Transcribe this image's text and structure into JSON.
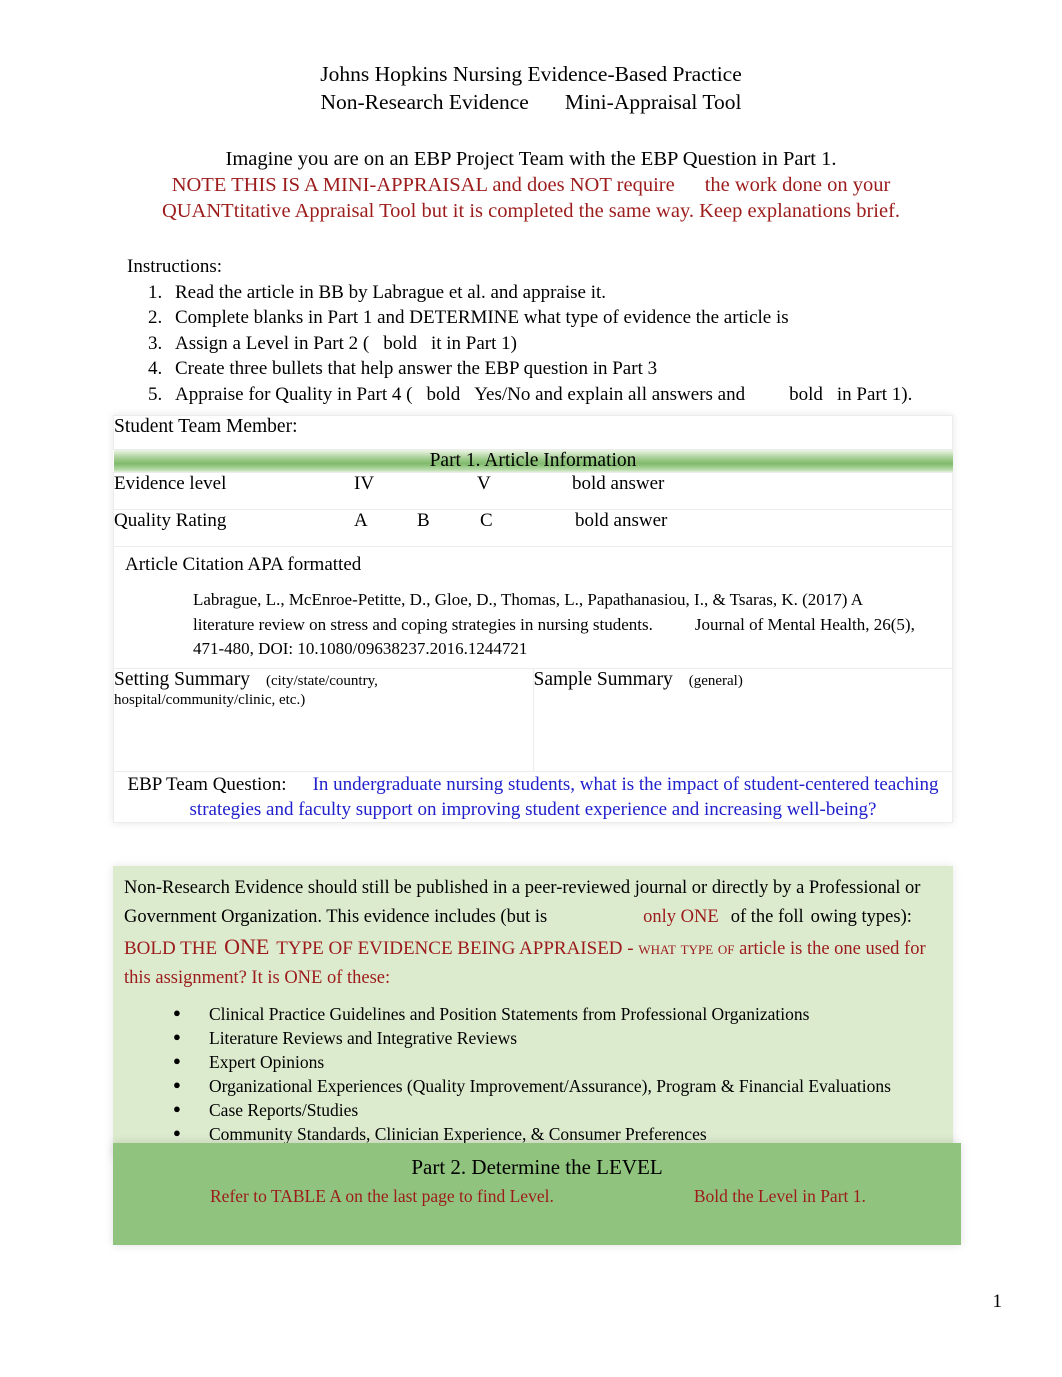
{
  "header": {
    "line1": "Johns Hopkins Nursing Evidence-Based Practice",
    "line2_a": "Non-Research Evidence",
    "line2_b": "Mini-Appraisal Tool"
  },
  "intro": {
    "line1": "Imagine you are on an EBP Project Team with the EBP Question in Part 1.",
    "note_a": "NOTE THIS IS A MINI-APPRAISAL and does NOT require",
    "note_b": "the work done on your",
    "note_c": "QUANTtitative Appraisal Tool but it is completed the same way. Keep explanations brief."
  },
  "instructions": {
    "heading": "Instructions:",
    "items": [
      {
        "text": "Read the article in BB by Labrague et al. and appraise it."
      },
      {
        "text": "Complete blanks in Part 1 and DETERMINE what type of evidence the article is"
      },
      {
        "a": "Assign a Level in Part 2 (",
        "b": "bold",
        "c": "it in Part 1)"
      },
      {
        "text": "Create three bullets that help answer the EBP question in Part 3"
      },
      {
        "a": "Appraise for Quality in Part 4 (",
        "b": "bold",
        "c": "Yes/No and explain all answers and",
        "d": "bold",
        "e": "in Part 1)."
      }
    ],
    "stray_dot": "."
  },
  "table": {
    "student_team_member_label": "Student Team Member:",
    "student_team_member_value": "",
    "part1_header": "Part 1. Article Information",
    "evidence_level": {
      "label": "Evidence level",
      "options": [
        "IV",
        "V"
      ],
      "answer_hint": "bold answer"
    },
    "quality_rating": {
      "label": "Quality Rating",
      "options": [
        "A",
        "B",
        "C"
      ],
      "answer_hint": "bold answer"
    },
    "citation": {
      "label": "Article Citation APA formatted",
      "text_a": "Labrague, L., McEnroe-Petitte, D., Gloe, D., Thomas, L., Papathanasiou, I., & Tsaras, K. (2017) A literature review on stress and coping strategies in nursing students.",
      "text_b": "Journal of Mental Health, 26(5), 471-480, DOI: 10.1080/09638237.2016.1244721"
    },
    "setting_summary": {
      "label": "Setting Summary",
      "hint_a": "(city/state/country,",
      "hint_b": "hospital/community/clinic, etc.)",
      "value": ""
    },
    "sample_summary": {
      "label": "Sample Summary",
      "hint": "(general)",
      "value": ""
    },
    "ebp_question": {
      "label": "EBP Team Question:",
      "text": "In undergraduate nursing students, what is the impact of student-centered teaching strategies and faculty support on improving student experience and increasing well-being?"
    }
  },
  "non_research_block": {
    "p_a": "Non-Research Evidence should still be published in a peer-reviewed journal or directly by a Professional or Government Organization. This evidence includes (but is",
    "p_only_one": "only ONE",
    "p_b": "of the foll",
    "p_c": "owing types):",
    "bold_the": "BOLD THE",
    "one": "ONE",
    "type_of_evidence": "TYPE OF EVIDENCE BEING APPRAISED - what type of",
    "p_d": "article is the one used for this assignment? It is ONE of these:",
    "evidence_types": [
      "Clinical Practice Guidelines and Position Statements from Professional Organizations",
      "Literature Reviews and Integrative Reviews",
      "Expert Opinions",
      "Organizational Experiences (Quality Improvement/Assurance), Program & Financial Evaluations",
      "Case Reports/Studies",
      "Community Standards, Clinician Experience, & Consumer Preferences"
    ]
  },
  "part2": {
    "title": "Part 2. Determine the LEVEL",
    "sub_a": "Refer to TABLE A on the last page to find Level.",
    "sub_b": "Bold the Level in Part 1."
  },
  "footer": {
    "page_number": "1"
  },
  "colors": {
    "accent_red": "#9C1B1B",
    "accent_blue": "#2020CC",
    "green_dark": "#90c47e",
    "green_light": "#dceace",
    "header_bar_green": "#7fba6b"
  }
}
